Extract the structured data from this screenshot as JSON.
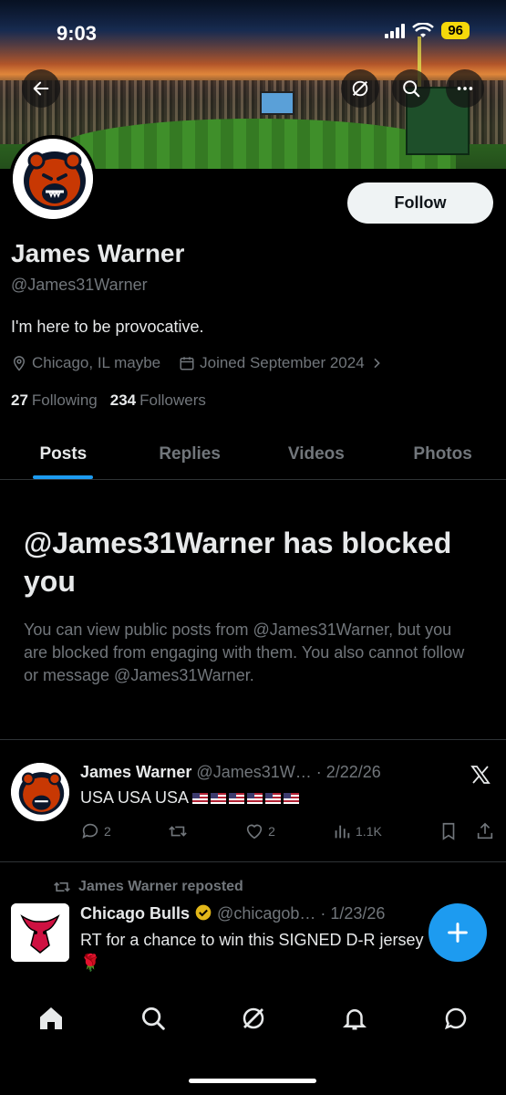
{
  "status_bar": {
    "time": "9:03",
    "battery": "96"
  },
  "profile": {
    "name": "James Warner",
    "handle": "@James31Warner",
    "bio": "I'm here to be provocative.",
    "location": "Chicago, IL maybe",
    "joined": "Joined September 2024",
    "following_count": "27",
    "following_label": "Following",
    "followers_count": "234",
    "followers_label": "Followers",
    "follow_label": "Follow"
  },
  "tabs": [
    {
      "label": "Posts",
      "active": true
    },
    {
      "label": "Replies"
    },
    {
      "label": "Videos"
    },
    {
      "label": "Photos"
    }
  ],
  "blocked": {
    "title": "@James31Warner has blocked you",
    "body": "You can view public posts from @James31Warner, but you are blocked from engaging with them. You also cannot follow or message @James31Warner."
  },
  "posts": [
    {
      "author": "James Warner",
      "handle": "@James31W…",
      "date": "· 2/22/26",
      "text": "USA USA USA",
      "flag_count": 6,
      "replies": "2",
      "likes": "2",
      "views": "1.1K"
    },
    {
      "repost_label": "James Warner reposted",
      "author": "Chicago Bulls",
      "handle": "@chicagob…",
      "date": "· 1/23/26",
      "text": "RT for a chance to win this SIGNED D-R jersey 🌹"
    }
  ],
  "colors": {
    "accent": "#1d9bf0",
    "muted": "#71767b",
    "text": "#e7e9ea",
    "border": "#2f3336"
  },
  "icons": [
    "back-arrow-icon",
    "grok-icon",
    "search-icon",
    "more-icon",
    "location-icon",
    "calendar-icon",
    "chevron-right-icon",
    "x-logo-icon",
    "reply-icon",
    "repost-icon",
    "like-icon",
    "views-icon",
    "bookmark-icon",
    "share-icon",
    "verified-badge-icon",
    "plus-icon",
    "home-icon",
    "explore-icon",
    "notifications-icon",
    "messages-icon"
  ]
}
